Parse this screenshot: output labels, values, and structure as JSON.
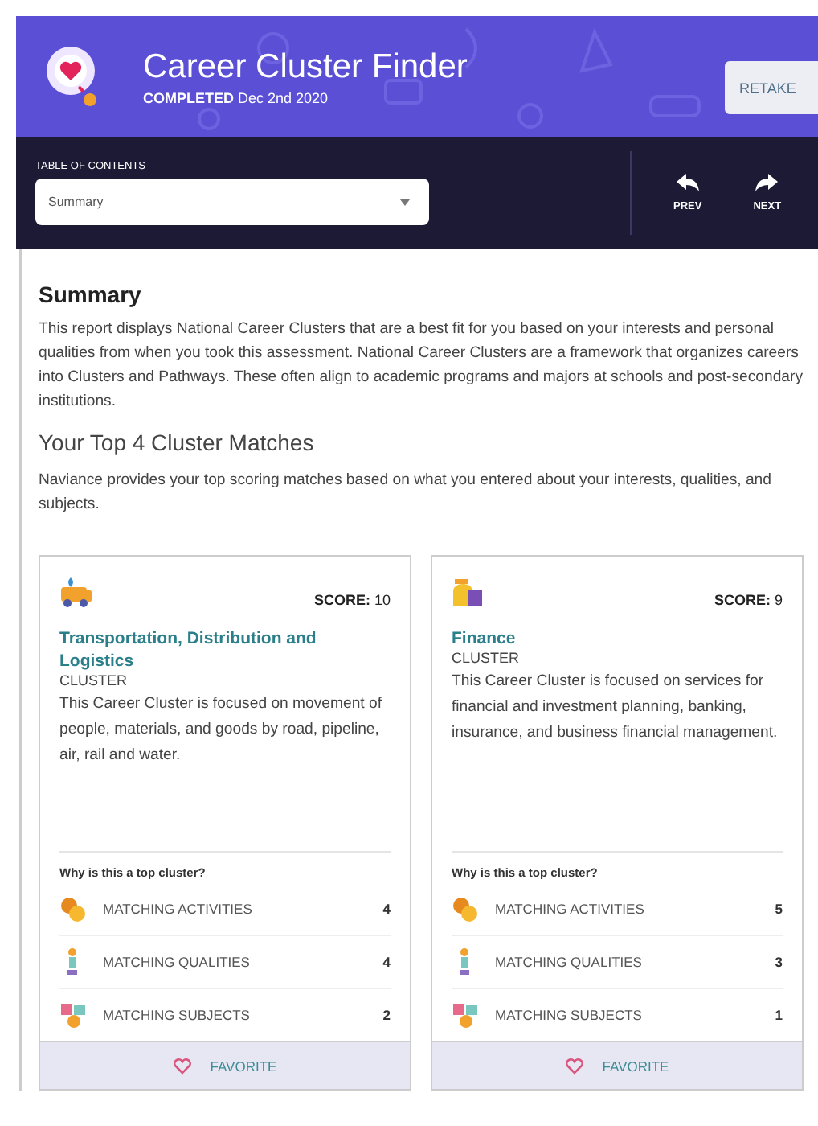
{
  "header": {
    "title": "Career Cluster Finder",
    "subtitle": "**COMPLETED** Dec 2nd 2020",
    "retake_button": "RETAKE"
  },
  "navigation": {
    "toc_label": "TABLE OF CONTENTS",
    "toc_value": "Summary",
    "prev": "PREV",
    "next": "NEXT"
  },
  "summary": {
    "heading": "Summary",
    "text": "This report displays National Career Clusters that are a best fit for you based on your interests and personal qualities from when you took this assessment. National Career Clusters are a framework that organizes careers into Clusters and Pathways. These often align to academic programs and majors at schools and post-secondary institutions."
  },
  "matches": {
    "heading": "Your Top 4 Cluster Matches",
    "text": "Naviance provides your top scoring matches based on what you entered about your interests, qualities, and subjects.",
    "cards": [
      {
        "kind": "truck",
        "score_label": "SCORE:",
        "score": "10",
        "title": "Transportation, Distribution and Logistics",
        "type": "CLUSTER",
        "description": "This Career Cluster is focused on movement of people, materials, and goods by road, pipeline, air, rail and water.",
        "why_label": "Why is this a top cluster?",
        "reasons": [
          {
            "kind": "activities",
            "label": "MATCHING ACTIVITIES",
            "count": "4"
          },
          {
            "kind": "qualities",
            "label": "MATCHING QUALITIES",
            "count": "4"
          },
          {
            "kind": "subjects",
            "label": "MATCHING SUBJECTS",
            "count": "2"
          }
        ],
        "favorite": "FAVORITE",
        "favorited": false
      },
      {
        "kind": "money",
        "score_label": "SCORE:",
        "score": "9",
        "title": "Finance",
        "type": "CLUSTER",
        "description": "This Career Cluster is focused on services for financial and investment planning, banking, insurance, and business financial management.",
        "why_label": "Why is this a top cluster?",
        "reasons": [
          {
            "kind": "activities",
            "label": "MATCHING ACTIVITIES",
            "count": "5"
          },
          {
            "kind": "qualities",
            "label": "MATCHING QUALITIES",
            "count": "3"
          },
          {
            "kind": "subjects",
            "label": "MATCHING SUBJECTS",
            "count": "1"
          }
        ],
        "favorite": "FAVORITE",
        "favorited": false
      }
    ]
  }
}
